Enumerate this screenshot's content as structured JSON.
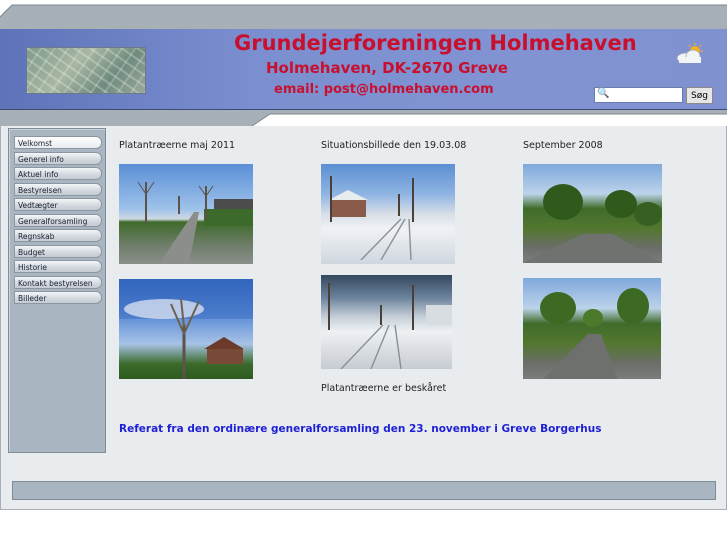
{
  "header": {
    "title": "Grundejerforeningen Holmehaven",
    "subtitle": "Holmehaven, DK-2670 Greve",
    "email": "email: post@holmehaven.com"
  },
  "search": {
    "placeholder": "",
    "button_label": "Søg"
  },
  "sidebar": {
    "items": [
      {
        "label": "Velkomst"
      },
      {
        "label": "Generel info"
      },
      {
        "label": "Aktuel info"
      },
      {
        "label": "Bestyrelsen"
      },
      {
        "label": "Vedtægter"
      },
      {
        "label": "Generalforsamling"
      },
      {
        "label": "Regnskab"
      },
      {
        "label": "Budget"
      },
      {
        "label": "Historie"
      },
      {
        "label": "Kontakt bestyrelsen"
      },
      {
        "label": "Billeder"
      }
    ]
  },
  "gallery": {
    "columns": [
      {
        "caption": "Platantræerne maj 2011"
      },
      {
        "caption": "Situationsbillede den 19.03.08",
        "bottom_caption": "Platantræerne er beskåret"
      },
      {
        "caption": "September 2008"
      }
    ]
  },
  "main": {
    "referat_link": "Referat fra den ordinære generalforsamling den 23. november i Greve Borgerhus"
  },
  "colors": {
    "header_blue": "#7b8fd0",
    "title_red": "#c8102e",
    "link_blue": "#1f1fd6",
    "sidebar_gray": "#a9b5c0",
    "content_bg": "#e8ecef"
  },
  "icons": {
    "weather": "sun-cloud-icon",
    "search": "magnifier-icon"
  }
}
